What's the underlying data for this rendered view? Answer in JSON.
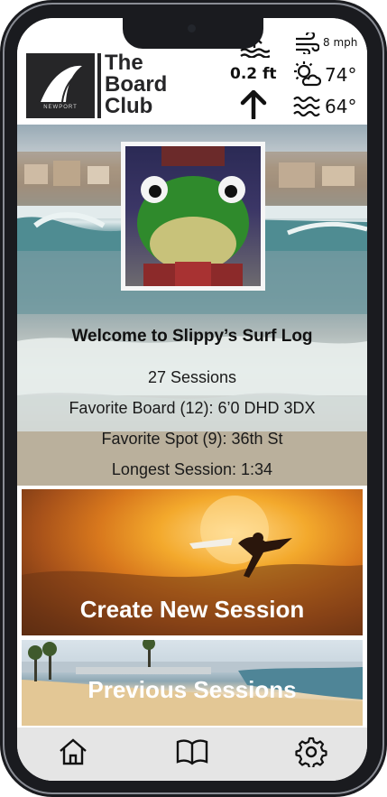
{
  "header": {
    "logo_text": [
      "The",
      "Board",
      "Club"
    ],
    "logo_subtext": "NEWPORT",
    "tide": {
      "height": "0.2 ft",
      "direction": "rising"
    },
    "wind": {
      "speed": "8 mph"
    },
    "air_temp": "74°",
    "water_temp": "64°"
  },
  "profile": {
    "welcome": "Welcome to Slippy’s Surf Log",
    "stats": [
      "27 Sessions",
      "Favorite Board (12): 6’0 DHD 3DX",
      "Favorite Spot (9): 36th St",
      "Longest Session: 1:34"
    ]
  },
  "cards": {
    "create_label": "Create New Session",
    "previous_label": "Previous Sessions"
  },
  "tabbar": {
    "items": [
      "home-icon",
      "book-icon",
      "gear-icon"
    ]
  },
  "icons": [
    "tide-icon",
    "arrow-up-icon",
    "wind-icon",
    "sun-cloud-icon",
    "waves-icon"
  ]
}
